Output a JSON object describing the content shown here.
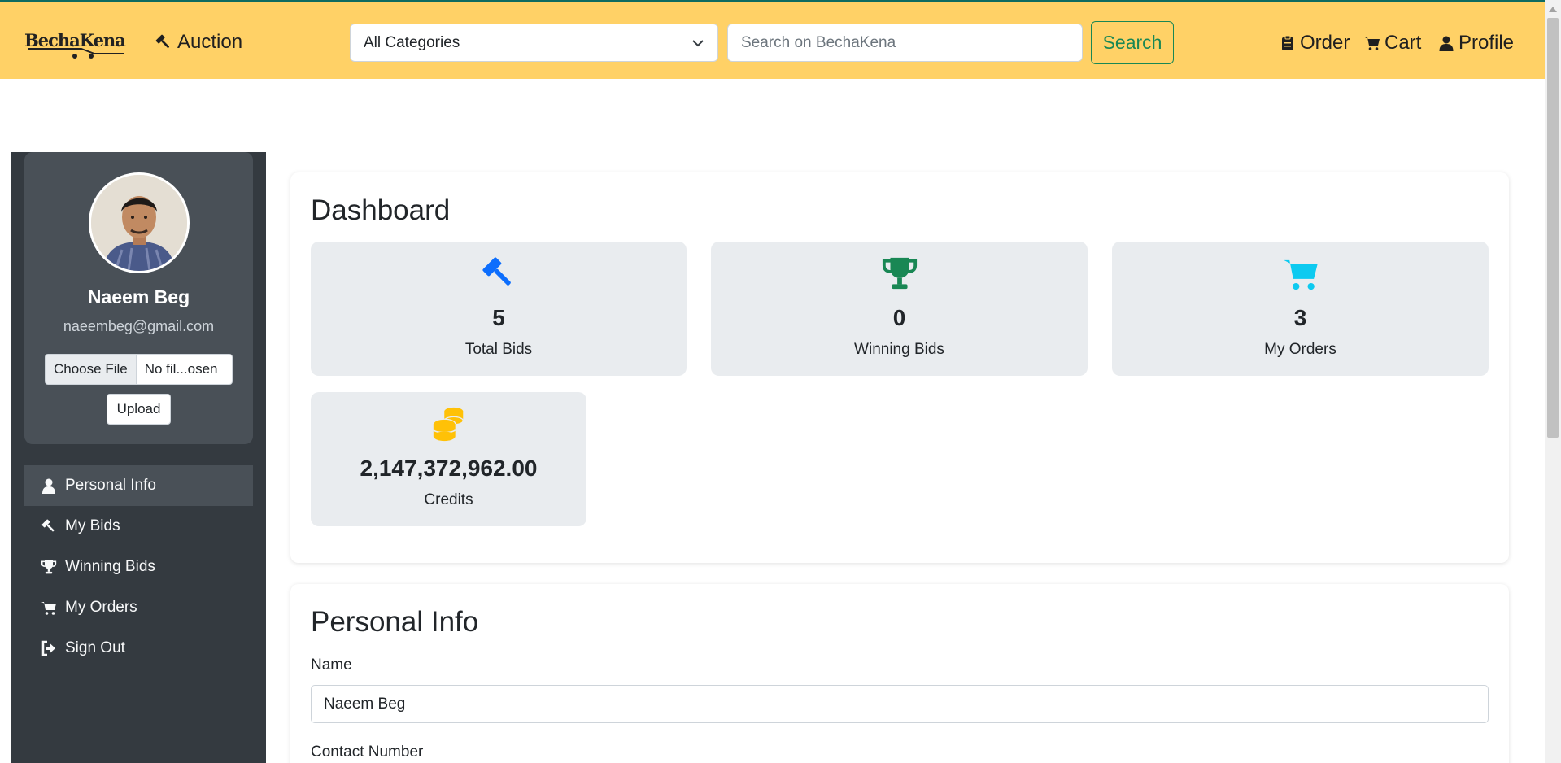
{
  "header": {
    "logo_text": "BechaKena",
    "auction_label": "Auction",
    "category_selected": "All Categories",
    "search_placeholder": "Search on BechaKena",
    "search_button": "Search",
    "order_label": "Order",
    "cart_label": "Cart",
    "profile_label": "Profile",
    "accent_color": "#ffd166"
  },
  "sidebar": {
    "user_name": "Naeem Beg",
    "user_email": "naeembeg@gmail.com",
    "file_choose_label": "Choose File",
    "file_name": "No fil...osen",
    "upload_label": "Upload",
    "items": [
      {
        "label": "Personal Info",
        "icon": "user-icon",
        "active": true
      },
      {
        "label": "My Bids",
        "icon": "gavel-icon",
        "active": false
      },
      {
        "label": "Winning Bids",
        "icon": "trophy-icon",
        "active": false
      },
      {
        "label": "My Orders",
        "icon": "cart-icon",
        "active": false
      },
      {
        "label": "Sign Out",
        "icon": "sign-out-icon",
        "active": false
      }
    ]
  },
  "dashboard": {
    "title": "Dashboard",
    "stats": [
      {
        "value": "5",
        "label": "Total Bids",
        "icon": "gavel-icon",
        "color": "#0d6efd"
      },
      {
        "value": "0",
        "label": "Winning Bids",
        "icon": "trophy-icon",
        "color": "#198754"
      },
      {
        "value": "3",
        "label": "My Orders",
        "icon": "cart-icon",
        "color": "#0dcaf0"
      },
      {
        "value": "2,147,372,962.00",
        "label": "Credits",
        "icon": "coins-icon",
        "color": "#ffc107"
      }
    ]
  },
  "personal_info": {
    "title": "Personal Info",
    "name_label": "Name",
    "name_value": "Naeem Beg",
    "contact_label": "Contact Number"
  }
}
